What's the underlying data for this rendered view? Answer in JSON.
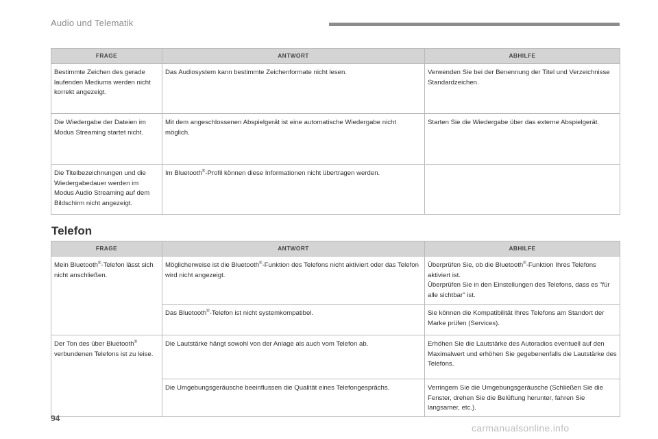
{
  "header": {
    "title": "Audio und Telematik"
  },
  "audio_table": {
    "columns": [
      "FRAGE",
      "ANTWORT",
      "ABHILFE"
    ],
    "rows": [
      {
        "frage": "Bestimmte Zeichen des gerade laufenden Mediums werden nicht korrekt angezeigt.",
        "antwort": "Das Audiosystem kann bestimmte Zeichenformate nicht lesen.",
        "abhilfe": "Verwenden Sie bei der Benennung der Titel und Verzeichnisse Standardzeichen."
      },
      {
        "frage": "Die Wiedergabe der Dateien im Modus Streaming startet nicht.",
        "antwort": "Mit dem angeschlossenen Abspielgerät ist eine automatische Wiedergabe nicht möglich.",
        "abhilfe": "Starten Sie die Wiedergabe über das externe Abspielgerät."
      },
      {
        "frage": "Die Titelbezeichnungen und die Wiedergabedauer werden im Modus Audio Streaming auf dem Bildschirm nicht angezeigt.",
        "antwort_a": "Im Bluetooth",
        "antwort_sup": "®",
        "antwort_b": "-Profil können diese Informationen nicht übertragen werden.",
        "abhilfe": ""
      }
    ]
  },
  "telefon_section": {
    "title": "Telefon"
  },
  "telefon_table": {
    "columns": [
      "FRAGE",
      "ANTWORT",
      "ABHILFE"
    ],
    "row1": {
      "frage_a": "Mein Bluetooth",
      "frage_sup": "®",
      "frage_b": "-Telefon lässt sich nicht anschließen.",
      "answers": [
        {
          "antwort_a": "Möglicherweise ist die Bluetooth",
          "antwort_sup": "®",
          "antwort_b": "-Funktion des Telefons nicht aktiviert oder das Telefon wird nicht angezeigt.",
          "abhilfe_a": "Überprüfen Sie, ob die Bluetooth",
          "abhilfe_sup": "®",
          "abhilfe_b": "-Funktion Ihres Telefons aktiviert ist.",
          "abhilfe_c": "Überprüfen Sie in den Einstellungen des Telefons, dass es \"für alle sichtbar\" ist."
        },
        {
          "antwort_a": "Das Bluetooth",
          "antwort_sup": "®",
          "antwort_b": "-Telefon ist nicht systemkompatibel.",
          "abhilfe": "Sie können die Kompatibilität Ihres Telefons am Standort der Marke prüfen (Services)."
        }
      ]
    },
    "row2": {
      "frage_a": "Der Ton des über Bluetooth",
      "frage_sup": "®",
      "frage_b": " verbundenen Telefons ist zu leise.",
      "answers": [
        {
          "antwort": "Die Lautstärke hängt sowohl von der Anlage als auch vom Telefon ab.",
          "abhilfe": "Erhöhen Sie die Lautstärke des Autoradios eventuell auf den Maximalwert und erhöhen Sie gegebenenfalls die Lautstärke des Telefons."
        },
        {
          "antwort": "Die Umgebungsgeräusche beeinflussen die Qualität eines Telefongesprächs.",
          "abhilfe": "Verringern Sie die Umgebungsgeräusche (Schließen Sie die Fenster, drehen Sie die Belüftung herunter, fahren Sie langsamer, etc.)."
        }
      ]
    }
  },
  "footer": {
    "page_number": "94",
    "watermark": "carmanualsonline.info"
  }
}
